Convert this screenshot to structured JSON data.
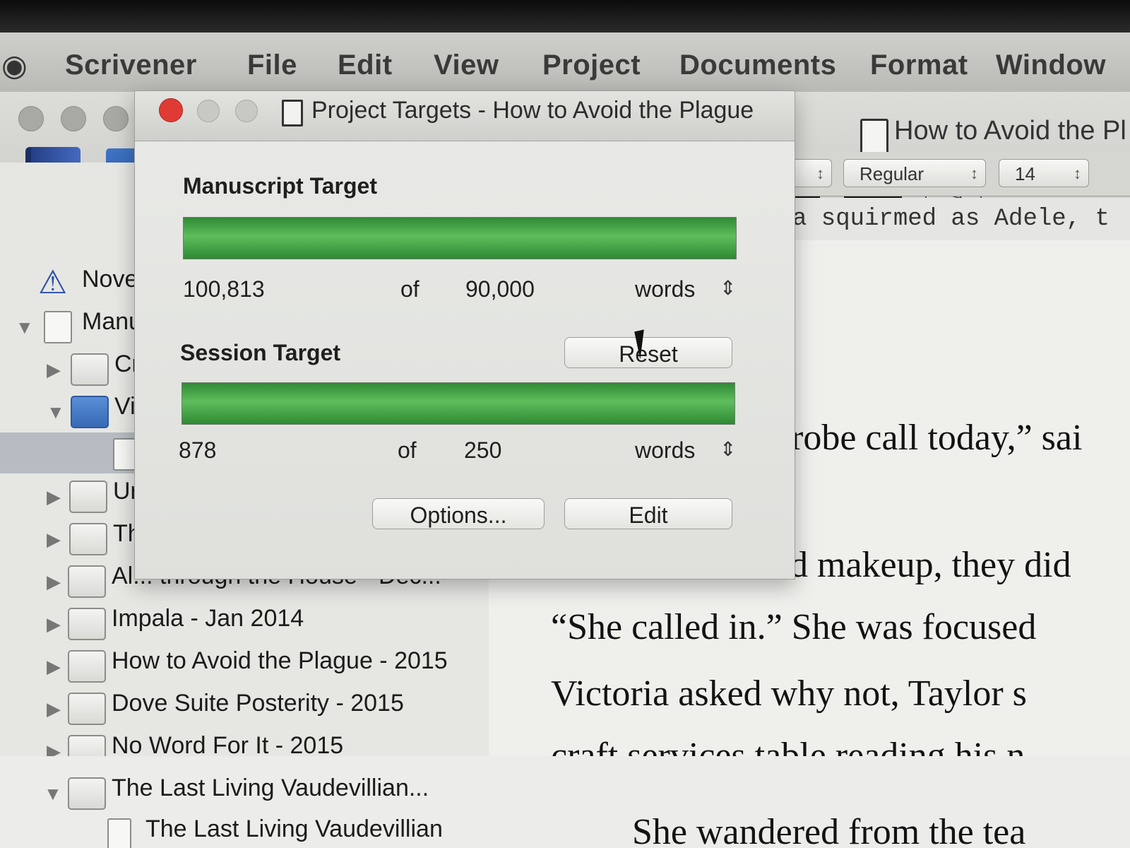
{
  "menubar": {
    "items": [
      "Scrivener",
      "File",
      "Edit",
      "View",
      "Project",
      "Documents",
      "Format",
      "Window"
    ]
  },
  "window": {
    "document_title": "How to Avoid the Pl"
  },
  "format_bar": {
    "style": "Regular",
    "size": "14"
  },
  "editor_header": "a squirmed as Adele, t",
  "editor": {
    "lines": [
      "robe call today,” sai",
      "d makeup, they did",
      "“She called in.” She was focused",
      "Victoria asked why not, Taylor s",
      "craft services table reading his n",
      "She wandered from the tea"
    ]
  },
  "binder": {
    "items": [
      {
        "label": "Nove",
        "icon": "warning-icon",
        "disclosure": ""
      },
      {
        "label": "Manu",
        "icon": "manuscript-icon",
        "disclosure": "▼"
      },
      {
        "label": "Cr",
        "icon": "folder-icon",
        "disclosure": "▶"
      },
      {
        "label": "Vi",
        "icon": "folder-icon",
        "disclosure": "▼"
      },
      {
        "label": "",
        "icon": "document-icon",
        "disclosure": ""
      },
      {
        "label": "Ur",
        "icon": "folder-icon",
        "disclosure": "▶"
      },
      {
        "label": "Th",
        "icon": "folder-icon",
        "disclosure": "▶"
      },
      {
        "label": "Al... through the House - Dec...",
        "icon": "folder-icon",
        "disclosure": "▶"
      },
      {
        "label": "Impala - Jan 2014",
        "icon": "folder-icon",
        "disclosure": "▶"
      },
      {
        "label": "How to Avoid the Plague - 2015",
        "icon": "folder-icon",
        "disclosure": "▶"
      },
      {
        "label": "Dove Suite Posterity - 2015",
        "icon": "folder-icon",
        "disclosure": "▶"
      },
      {
        "label": "No Word For It - 2015",
        "icon": "folder-icon",
        "disclosure": "▶"
      },
      {
        "label": "The Last Living Vaudevillian...",
        "icon": "folder-icon",
        "disclosure": "▼"
      },
      {
        "label": "The Last Living Vaudevillian",
        "icon": "document-icon",
        "disclosure": ""
      }
    ]
  },
  "targets_panel": {
    "title": "Project Targets - How to Avoid the Plague",
    "manuscript": {
      "label": "Manuscript Target",
      "count": "100,813",
      "of": "of",
      "target": "90,000",
      "unit": "words",
      "progress": 1.0
    },
    "session": {
      "label": "Session Target",
      "reset_label": "Reset",
      "count": "878",
      "of": "of",
      "target": "250",
      "unit": "words",
      "progress": 1.0
    },
    "options_label": "Options...",
    "edit_label": "Edit"
  },
  "colors": {
    "progress_green": "#3fa443",
    "close_red": "#e03a34"
  }
}
